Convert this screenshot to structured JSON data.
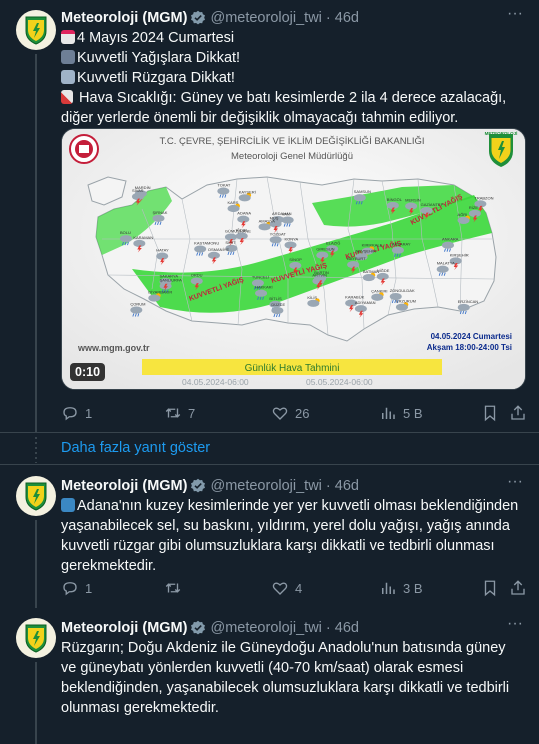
{
  "tweets": [
    {
      "name": "Meteoroloji (MGM)",
      "handle": "@meteoroloji_twi",
      "time": "46d",
      "lines": [
        "4 Mayıs 2024 Cumartesi",
        "Kuvvetli Yağışlara Dikkat!",
        "Kuvvetli Rüzgara Dikkat!",
        "Hava Sıcaklığı: Güney ve batı kesimlerde 2 ila 4 derece azalacağı, diğer yerlerde önemli bir değişiklik olmayacağı tahmin ediliyor."
      ],
      "media": {
        "header_line1": "T.C. ÇEVRE, ŞEHİRCİLİK VE İKLİM DEĞİŞİKLİĞİ BAKANLIĞI",
        "header_line2": "Meteoroloji Genel Müdürlüğü",
        "logo_text": "METEOROLOJİ",
        "date_label": "04.05.2024 Cumartesi",
        "time_label": "Akşam 18:00-24:00 Tsi",
        "website": "www.mgm.gov.tr",
        "banner": "Günlük Hava Tahmini",
        "range_start": "04.05.2024-06:00",
        "range_end": "05.05.2024-06:00",
        "duration": "0:10",
        "band_labels": [
          "KUVVETLİ YAĞIŞ",
          "KUVVETLİ YAĞIŞ",
          "KUVVETLİ YAĞIŞ",
          "KUVVETLİ YAĞIŞ"
        ],
        "cities": [
          "SİNOP",
          "KASTAMONU",
          "ÇORUM",
          "AMASYA",
          "SAMSUN",
          "ORDU",
          "GİRESUN",
          "TRABZON",
          "RİZE",
          "ARTVİN",
          "ARDAHAN",
          "KARS",
          "IĞDIR",
          "AĞRI",
          "VAN",
          "HAKKARİ",
          "ŞIRNAK",
          "MARDİN",
          "BATMAN",
          "SİİRT",
          "BİTLİS",
          "MUŞ",
          "BİNGÖL",
          "ERZURUM",
          "ERZİNCAN",
          "BAYBURT",
          "GÜMÜŞHANE",
          "TUNCELİ",
          "ELAZIĞ",
          "MALATYA",
          "DİYARBAKIR",
          "ŞANLIURFA",
          "ADIYAMAN",
          "GAZİANTEP",
          "KİLİS",
          "HATAY",
          "OSMANİYE",
          "ADANA",
          "MERSİN",
          "KARAMAN",
          "KONYA",
          "AKSARAY",
          "NİĞDE",
          "KAYSERİ",
          "SİVAS",
          "TOKAT",
          "YOZGAT",
          "KIRŞEHİR",
          "NEVŞEHİR",
          "KIRIKKALE",
          "ANKARA",
          "ÇANKIRI",
          "KARABÜK",
          "BARTIN",
          "ZONGULDAK",
          "DÜZCE",
          "BOLU",
          "SAKARYA",
          "KOCAELİ",
          "YALOVA",
          "İSTANBUL",
          "EDİRNE",
          "KIRKLARELİ",
          "TEKİRDAĞ",
          "ÇANAKKALE",
          "BALIKESİR",
          "BURSA",
          "BİLECİK",
          "ESKİŞEHİR",
          "KÜTAHYA",
          "UŞAK",
          "MANİSA",
          "İZMİR",
          "AYDIN",
          "MUĞLA",
          "DENİZLİ",
          "BURDUR",
          "ISPARTA",
          "AFYONKARAHİSAR",
          "ANTALYA"
        ]
      },
      "actions": {
        "replies": "1",
        "retweets": "7",
        "likes": "26",
        "views": "5 B"
      }
    },
    {
      "name": "Meteoroloji (MGM)",
      "handle": "@meteoroloji_twi",
      "time": "46d",
      "text": "Adana'nın kuzey kesimlerinde yer yer kuvvetli olması beklendiğinden yaşanabilecek sel, su baskını, yıldırım, yerel dolu yağışı, yağış anında kuvvetli rüzgar gibi olumsuzluklara karşı dikkatli ve tedbirli olunması gerekmektedir.",
      "actions": {
        "replies": "1",
        "retweets": "",
        "likes": "4",
        "views": "3 B"
      }
    },
    {
      "name": "Meteoroloji (MGM)",
      "handle": "@meteoroloji_twi",
      "time": "46d",
      "text": "Rüzgarın; Doğu Akdeniz ile Güneydoğu Anadolu'nun batısında güney ve güneybatı yönlerden kuvvetli (40-70 km/saat) olarak esmesi beklendiğinden, yaşanabilecek olumsuzluklara karşı dikkatli ve tedbirli olunması gerekmektedir.",
      "actions": {
        "replies": "",
        "retweets": "",
        "likes": "4",
        "views": "3 B"
      }
    }
  ],
  "show_more_replies": "Daha fazla yanıt göster",
  "colors": {
    "background": "#15202b",
    "border": "#38444d",
    "text": "#f7f9f9",
    "secondary": "#8b98a5",
    "link": "#1d9bf0",
    "warning_band": "#3bd83b",
    "banner_yellow": "#f7e53f"
  },
  "icons": [
    "calendar-icon",
    "rain-cloud-icon",
    "wind-icon",
    "thermometer-icon",
    "up-right-arrow-icon",
    "verified-icon",
    "more-icon",
    "reply-icon",
    "retweet-icon",
    "like-icon",
    "views-icon",
    "bookmark-icon",
    "share-icon"
  ]
}
